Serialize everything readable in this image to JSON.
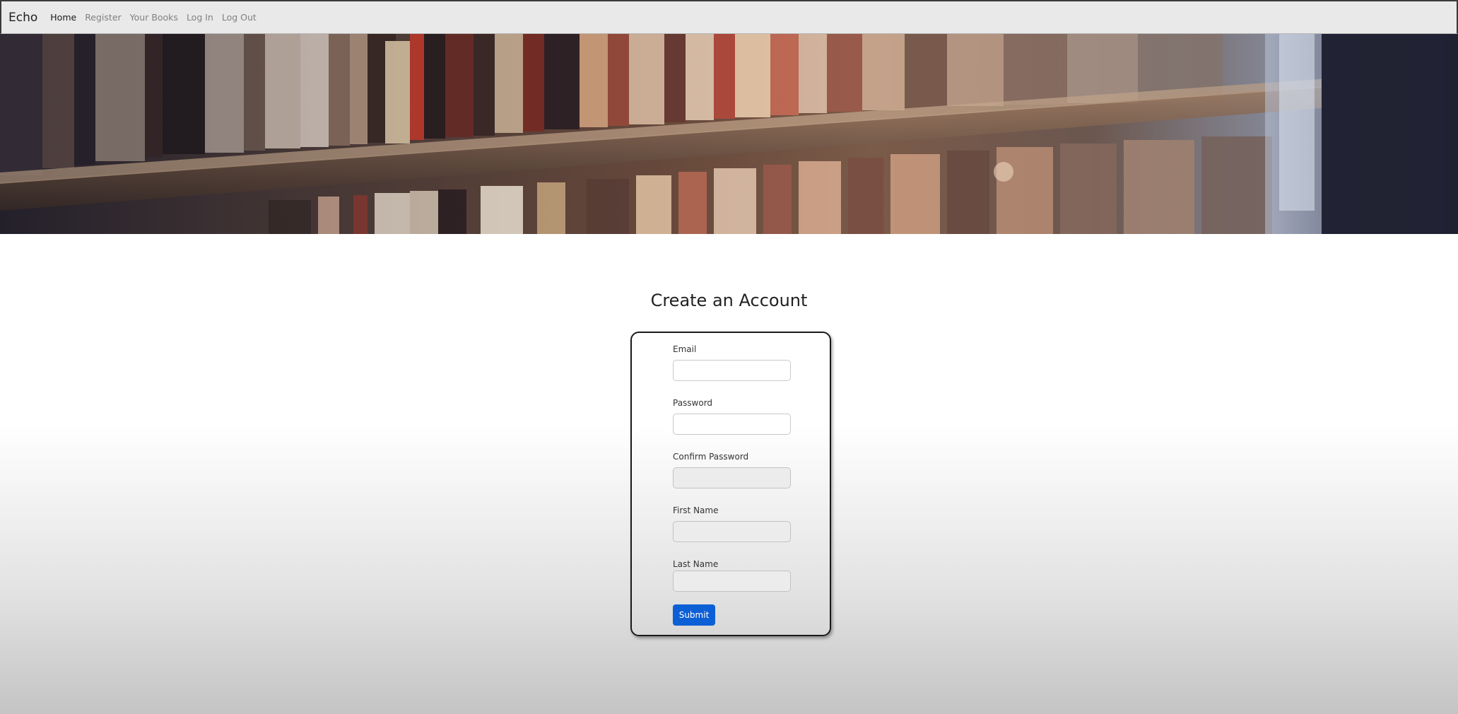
{
  "nav": {
    "brand": "Echo",
    "links": [
      {
        "label": "Home",
        "active": true
      },
      {
        "label": "Register",
        "active": false
      },
      {
        "label": "Your Books",
        "active": false
      },
      {
        "label": "Log In",
        "active": false
      },
      {
        "label": "Log Out",
        "active": false
      }
    ]
  },
  "hero": {
    "image": "library-bookshelves-banner"
  },
  "form": {
    "title": "Create an Account",
    "fields": [
      {
        "label": "Email",
        "value": "",
        "type": "email"
      },
      {
        "label": "Password",
        "value": "",
        "type": "password"
      },
      {
        "label": "Confirm Password",
        "value": "",
        "type": "password"
      },
      {
        "label": "First Name",
        "value": "",
        "type": "text"
      },
      {
        "label": "Last Name",
        "value": "",
        "type": "text"
      }
    ],
    "submit_label": "Submit"
  },
  "colors": {
    "primary_button": "#0d5fd6",
    "navbar_bg": "#e9e9e9"
  }
}
